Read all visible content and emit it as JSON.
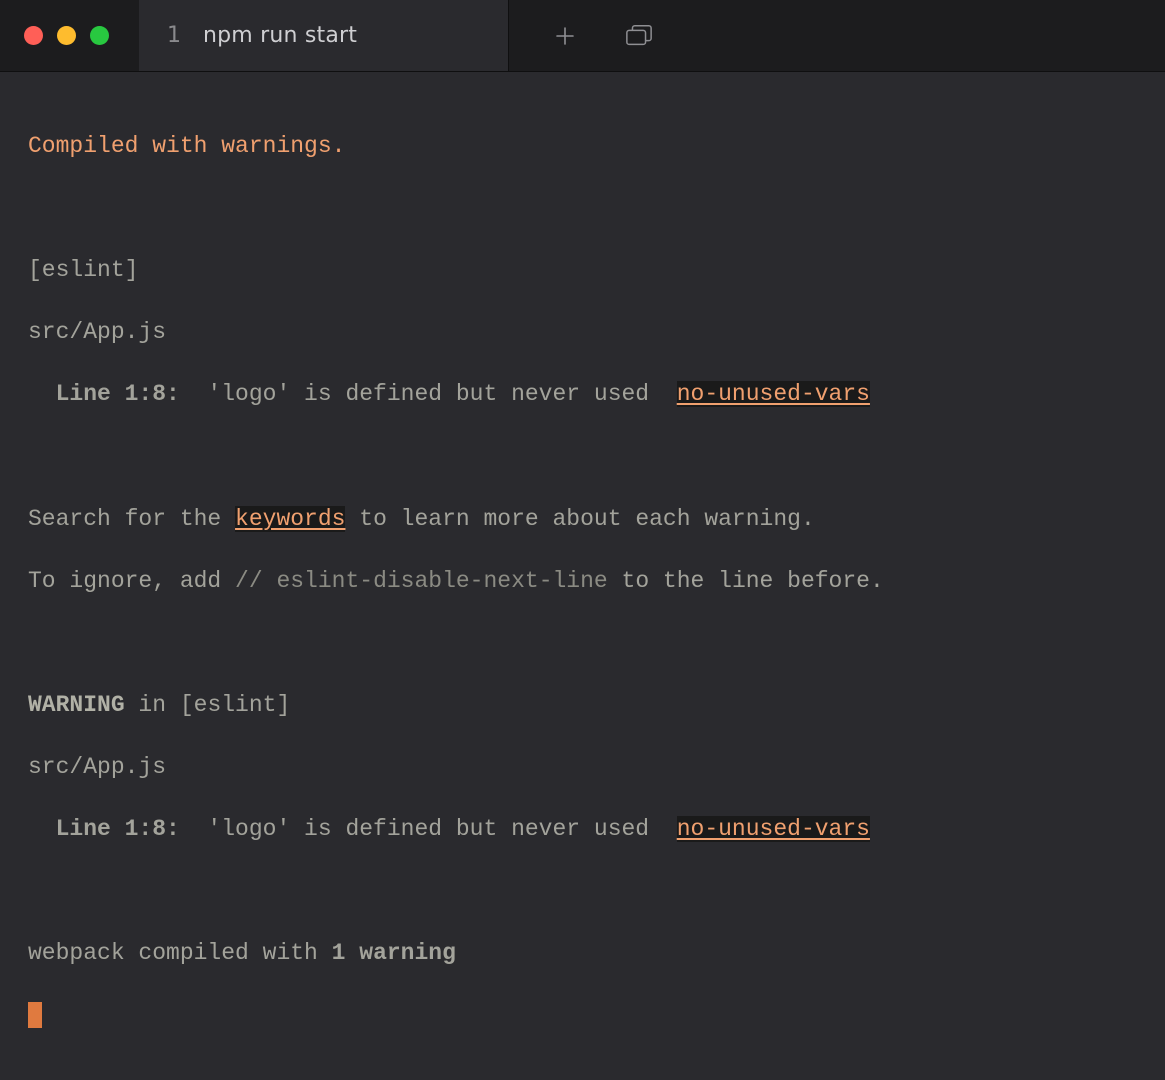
{
  "window": {
    "tab_index": "1",
    "tab_title": "npm run start"
  },
  "output": {
    "compiled_header": "Compiled with warnings.",
    "eslint_tag": "[eslint]",
    "file": "src/App.js",
    "line_prefix": "  Line 1:8:",
    "msg": "  'logo' is defined but never used  ",
    "rule": "no-unused-vars",
    "search_prefix": "Search for the ",
    "keywords": "keywords",
    "search_suffix": " to learn more about each warning.",
    "ignore_prefix": "To ignore, add ",
    "ignore_comment": "// eslint-disable-next-line",
    "ignore_suffix": " to the line before.",
    "warning": "WARNING",
    "in_eslint": " in [eslint]",
    "webpack_prefix": "webpack compiled with ",
    "webpack_count": "1 warning"
  }
}
